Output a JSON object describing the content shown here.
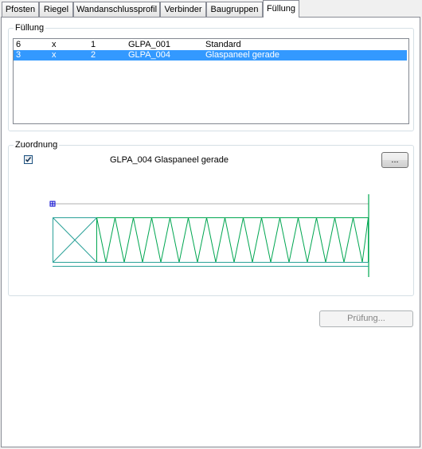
{
  "tabs": [
    {
      "label": "Pfosten"
    },
    {
      "label": "Riegel"
    },
    {
      "label": "Wandanschlussprofil"
    },
    {
      "label": "Verbinder"
    },
    {
      "label": "Baugruppen"
    },
    {
      "label": "Füllung"
    }
  ],
  "active_tab": "Füllung",
  "fuellung_group": {
    "title": "Füllung",
    "rows": [
      {
        "c1": "6",
        "c2": "x",
        "c3": "1",
        "c4": "GLPA_001",
        "c5": "Standard",
        "selected": false
      },
      {
        "c1": "3",
        "c2": "x",
        "c3": "2",
        "c4": "GLPA_004",
        "c5": "Glaspaneel gerade",
        "selected": true
      }
    ]
  },
  "zuordnung_group": {
    "title": "Zuordnung",
    "checkbox_checked": true,
    "assignment_label": "GLPA_004 Glaspaneel gerade",
    "browse_button": "..."
  },
  "pruefung_button": "Prüfung...",
  "colors": {
    "selection": "#3399ff",
    "drawing_green": "#00b050",
    "drawing_teal": "#2aa198",
    "marker_blue": "#0000cc"
  }
}
